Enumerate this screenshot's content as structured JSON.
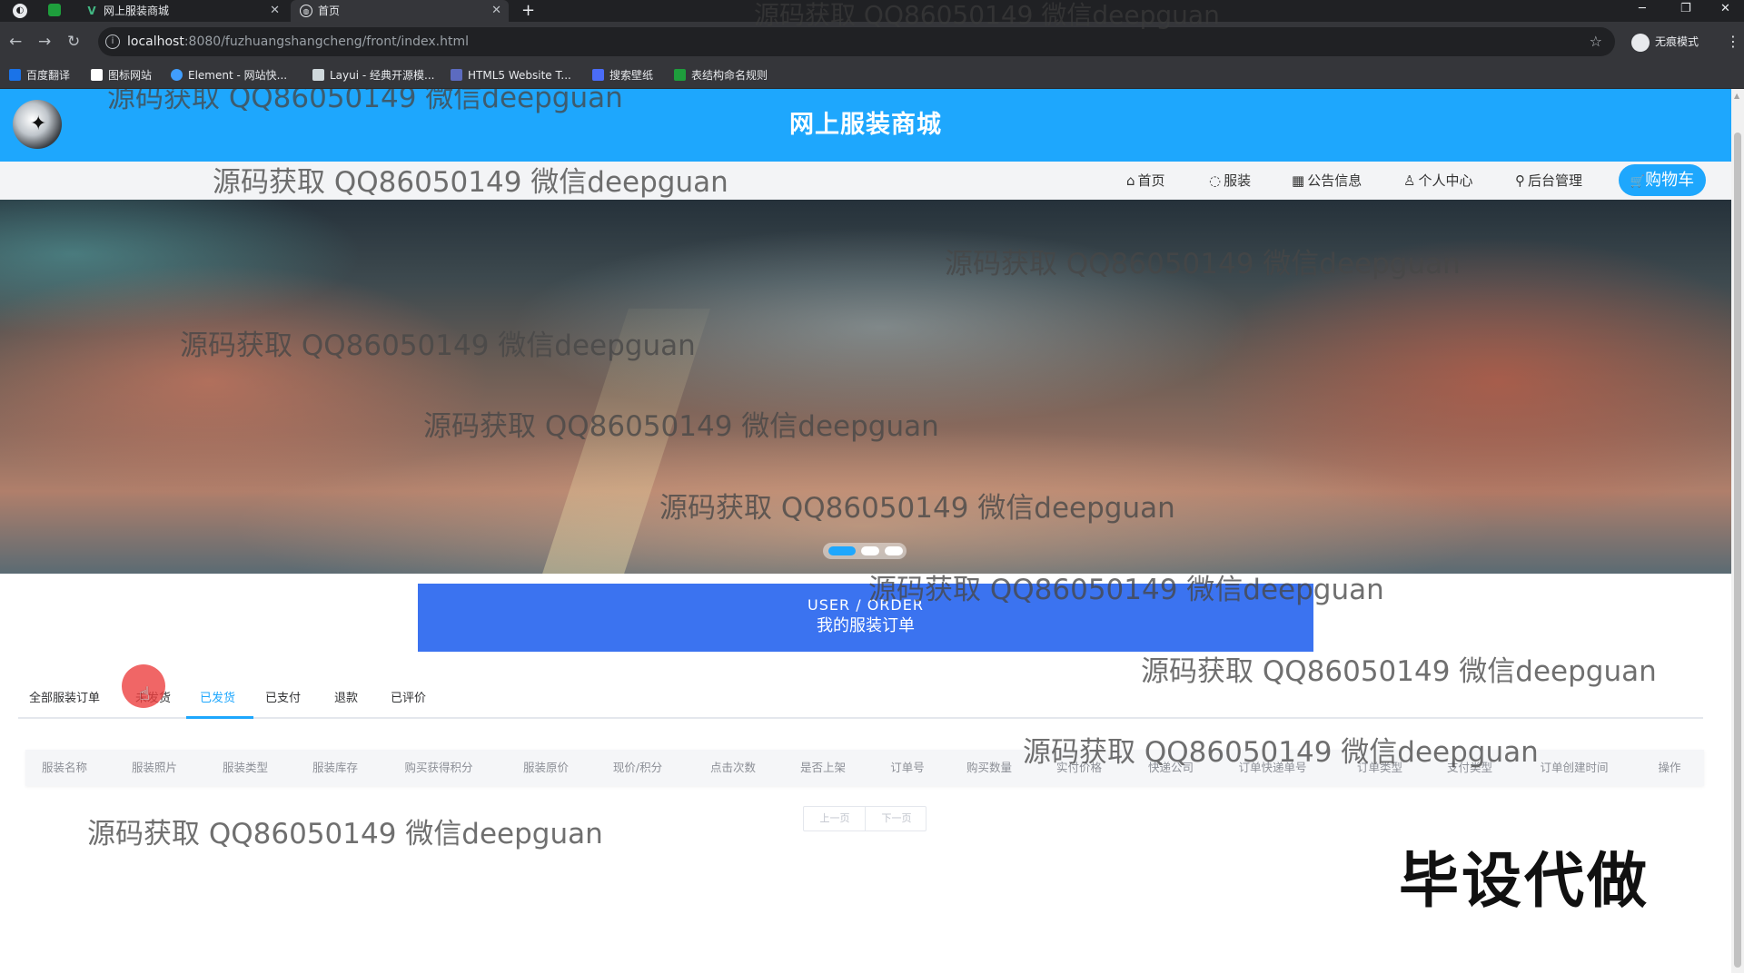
{
  "browser": {
    "tabs": [
      {
        "title": "网上服装商城",
        "active": false
      },
      {
        "title": "首页",
        "active": true
      }
    ],
    "new_tab": "+",
    "url_host": "localhost",
    "url_rest": ":8080/fuzhuangshangcheng/front/index.html",
    "profile_label": "无痕模式",
    "bookmarks": [
      {
        "label": "百度翻译",
        "color": "#1a73e8"
      },
      {
        "label": "图标网站",
        "color": "#ffffff"
      },
      {
        "label": "Element - 网站快...",
        "color": "#409eff"
      },
      {
        "label": "Layui - 经典开源模...",
        "color": "#cfd8dc"
      },
      {
        "label": "HTML5 Website T...",
        "color": "#5c6bc0"
      },
      {
        "label": "搜索壁纸",
        "color": "#4a6cf7"
      },
      {
        "label": "表结构命名规则",
        "color": "#1e9e3c"
      }
    ]
  },
  "site": {
    "title": "网上服装商城",
    "nav": [
      {
        "icon": "⌂",
        "label": "首页"
      },
      {
        "icon": "◌",
        "label": "服装"
      },
      {
        "icon": "▦",
        "label": "公告信息"
      },
      {
        "icon": "♙",
        "label": "个人中心"
      },
      {
        "icon": "⚲",
        "label": "后台管理"
      }
    ],
    "cart_label": "购物车",
    "cart_icon": "🛒"
  },
  "banner": {
    "en": "USER / ORDER",
    "cn": "我的服装订单"
  },
  "order_tabs": [
    {
      "label": "全部服装订单",
      "active": false
    },
    {
      "label": "未发货",
      "active": false
    },
    {
      "label": "已发货",
      "active": true
    },
    {
      "label": "已支付",
      "active": false
    },
    {
      "label": "退款",
      "active": false
    },
    {
      "label": "已评价",
      "active": false
    }
  ],
  "table_columns": [
    "服装名称",
    "服装照片",
    "服装类型",
    "服装库存",
    "购买获得积分",
    "服装原价",
    "现价/积分",
    "点击次数",
    "是否上架",
    "订单号",
    "购买数量",
    "实付价格",
    "快递公司",
    "订单快递单号",
    "订单类型",
    "支付类型",
    "订单创建时间",
    "操作"
  ],
  "pagination": {
    "prev": "上一页",
    "next": "下一页"
  },
  "stamp": "毕设代做",
  "watermark": "源码获取 QQ86050149 微信deepguan"
}
